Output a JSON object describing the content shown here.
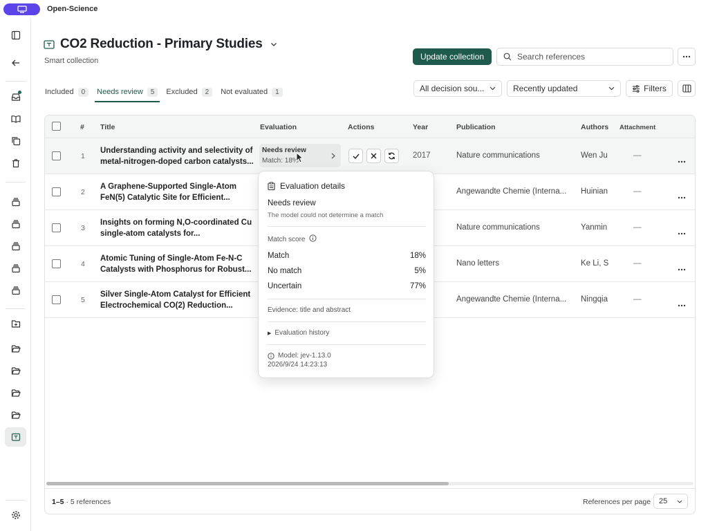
{
  "app": {
    "name": "Open-Science"
  },
  "header": {
    "title": "CO2 Reduction - Primary Studies",
    "subtitle": "Smart collection",
    "update_button": "Update collection",
    "search_placeholder": "Search references"
  },
  "tabs": [
    {
      "label": "Included",
      "count": "0"
    },
    {
      "label": "Needs review",
      "count": "5"
    },
    {
      "label": "Excluded",
      "count": "2"
    },
    {
      "label": "Not evaluated",
      "count": "1"
    }
  ],
  "toolbar": {
    "decision_source": "All decision sou...",
    "sort": "Recently updated",
    "filters_label": "Filters"
  },
  "table": {
    "columns": {
      "num": "#",
      "title": "Title",
      "evaluation": "Evaluation",
      "actions": "Actions",
      "year": "Year",
      "publication": "Publication",
      "authors": "Authors",
      "attachment": "Attachment"
    },
    "rows": [
      {
        "num": "1",
        "title_line1": "Understanding activity and selectivity of",
        "title_line2": "metal-nitrogen-doped carbon catalysts...",
        "eval_status": "Needs review",
        "eval_match": "Match: 18%",
        "year": "2017",
        "publication": "Nature communications",
        "authors": "Wen Ju",
        "attachment": "—"
      },
      {
        "num": "2",
        "title_line1": "A Graphene-Supported Single-Atom",
        "title_line2": "FeN(5) Catalytic Site for Efficient...",
        "publication": "Angewandte Chemie (Interna...",
        "authors": "Huinian",
        "attachment": "—"
      },
      {
        "num": "3",
        "title_line1": "Insights on forming N,O-coordinated Cu",
        "title_line2": "single-atom catalysts for...",
        "publication": "Nature communications",
        "authors": "Yanmin",
        "attachment": "—"
      },
      {
        "num": "4",
        "title_line1": "Atomic Tuning of Single-Atom Fe-N-C",
        "title_line2": "Catalysts with Phosphorus for Robust...",
        "publication": "Nano letters",
        "authors": "Ke Li, S",
        "attachment": "—"
      },
      {
        "num": "5",
        "title_line1": "Silver Single-Atom Catalyst for Efficient",
        "title_line2": "Electrochemical CO(2) Reduction...",
        "publication": "Angewandte Chemie (Interna...",
        "authors": "Ningqia",
        "attachment": "—"
      }
    ],
    "footer": {
      "range": "1–5",
      "total": " · 5 references",
      "per_page_label": "References per page",
      "per_page_value": "25"
    }
  },
  "popover": {
    "title": "Evaluation details",
    "status": "Needs review",
    "status_detail": "The model could not determine a match",
    "match_score_label": "Match score",
    "scores": [
      {
        "label": "Match",
        "value": "18%"
      },
      {
        "label": "No match",
        "value": "5%"
      },
      {
        "label": "Uncertain",
        "value": "77%"
      }
    ],
    "evidence": "Evidence: title and abstract",
    "history": "Evaluation history",
    "model": "Model: jev-1.13.0",
    "timestamp": "2026/9/24 14:23:13"
  },
  "colors": {
    "brand": "#5b44e8",
    "primary": "#1e5b4c"
  }
}
